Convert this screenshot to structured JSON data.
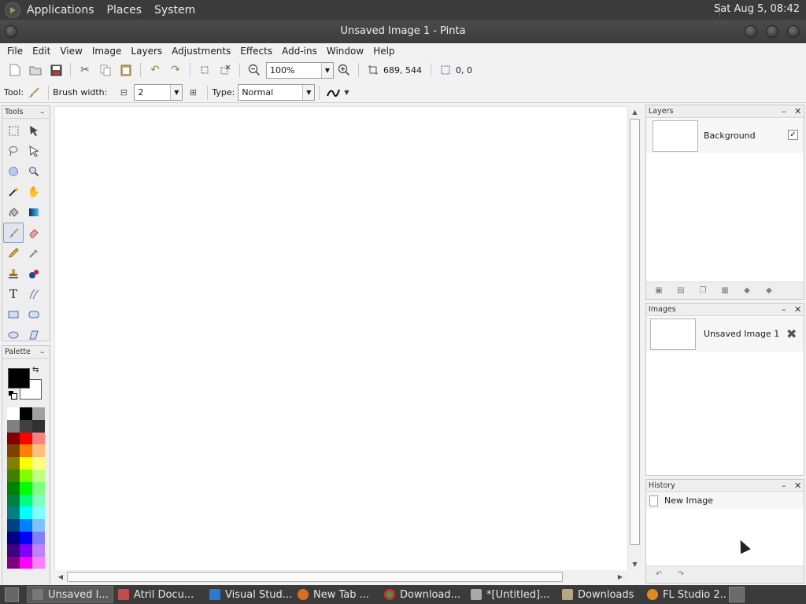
{
  "top_panel": {
    "menus": [
      "Applications",
      "Places",
      "System"
    ],
    "clock": "Sat Aug  5, 08:42"
  },
  "window": {
    "title": "Unsaved Image 1 - Pinta"
  },
  "menubar": [
    "File",
    "Edit",
    "View",
    "Image",
    "Layers",
    "Adjustments",
    "Effects",
    "Add-ins",
    "Window",
    "Help"
  ],
  "toolbar": {
    "zoom_value": "100%",
    "image_size": "689, 544",
    "selection_size": "0, 0"
  },
  "tool_options": {
    "tool_label": "Tool:",
    "brush_width_label": "Brush width:",
    "brush_width_value": "2",
    "type_label": "Type:",
    "type_value": "Normal"
  },
  "tools_panel": {
    "title": "Tools"
  },
  "palette_panel": {
    "title": "Palette",
    "primary_color": "#000000",
    "secondary_color": "#ffffff",
    "swatches": [
      "#ffffff",
      "#000000",
      "#a0a0a0",
      "#808080",
      "#404040",
      "#303030",
      "#800000",
      "#ff0000",
      "#ff8080",
      "#804000",
      "#ff8000",
      "#ffc080",
      "#808000",
      "#ffff00",
      "#ffff80",
      "#408000",
      "#80ff00",
      "#c0ff80",
      "#008000",
      "#00ff00",
      "#80ff80",
      "#008040",
      "#00ff80",
      "#80ffc0",
      "#008080",
      "#00ffff",
      "#80ffff",
      "#004080",
      "#0080ff",
      "#80c0ff",
      "#000080",
      "#0000ff",
      "#8080ff",
      "#400080",
      "#8000ff",
      "#c080ff",
      "#800080",
      "#ff00ff",
      "#ff80ff"
    ]
  },
  "layers_panel": {
    "title": "Layers",
    "layer_name": "Background"
  },
  "images_panel": {
    "title": "Images",
    "image_name": "Unsaved Image 1"
  },
  "history_panel": {
    "title": "History",
    "item": "New Image"
  },
  "taskbar": {
    "tasks": [
      "Unsaved I...",
      "Atril Docu...",
      "Visual Stud...",
      "New Tab ...",
      "Download...",
      "*[Untitled]...",
      "Downloads",
      "FL Studio 2..."
    ]
  }
}
